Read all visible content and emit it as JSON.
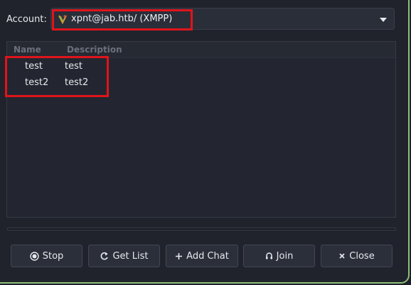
{
  "account": {
    "label": "Account:",
    "selected": "xpnt@jab.htb/ (XMPP)",
    "icon": "pidgin-xmpp-icon"
  },
  "room_list": {
    "columns": [
      "Name",
      "Description"
    ],
    "rows": [
      {
        "name": "test",
        "description": "test"
      },
      {
        "name": "test2",
        "description": "test2"
      }
    ]
  },
  "buttons": {
    "stop": "Stop",
    "get_list": "Get List",
    "add_chat": "Add Chat",
    "join": "Join",
    "close": "Close"
  },
  "colors": {
    "highlight": "#e0141b",
    "window_border": "#8fbf7a"
  }
}
